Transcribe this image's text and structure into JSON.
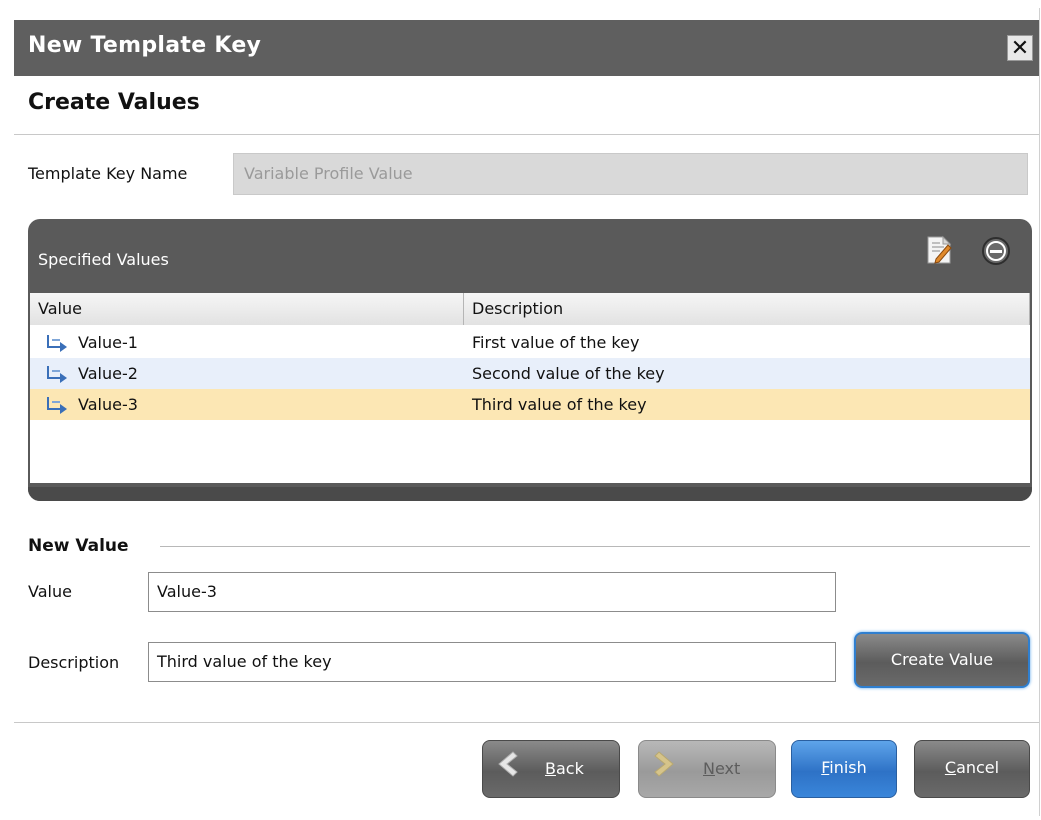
{
  "window": {
    "title": "New Template Key",
    "close_label": "✕"
  },
  "page": {
    "subtitle": "Create Values"
  },
  "template_key": {
    "label": "Template Key Name",
    "value": "Variable Profile Value"
  },
  "specified_values": {
    "title": "Specified Values",
    "columns": [
      "Value",
      "Description"
    ],
    "rows": [
      {
        "value": "Value-1",
        "description": "First value of the key",
        "state": "normal"
      },
      {
        "value": "Value-2",
        "description": "Second value of the key",
        "state": "alternate"
      },
      {
        "value": "Value-3",
        "description": "Third value of the key",
        "state": "selected"
      }
    ]
  },
  "new_value": {
    "section_title": "New Value",
    "value_label": "Value",
    "value": "Value-3",
    "description_label": "Description",
    "description": "Third value of the key",
    "create_button": "Create Value"
  },
  "footer": {
    "back": {
      "mnemonic": "B",
      "rest": "ack"
    },
    "next": {
      "mnemonic": "N",
      "rest": "ext"
    },
    "finish": {
      "mnemonic": "F",
      "rest": "inish"
    },
    "cancel": {
      "mnemonic": "C",
      "rest": "ancel"
    }
  },
  "colors": {
    "titlebar": "#5f5f5f",
    "selected_row": "#fce7b4",
    "alt_row": "#e8effa",
    "accent_blue": "#2e72c6"
  },
  "icons": {
    "edit": "edit-icon",
    "remove": "remove-icon",
    "row": "arrow-icon"
  }
}
